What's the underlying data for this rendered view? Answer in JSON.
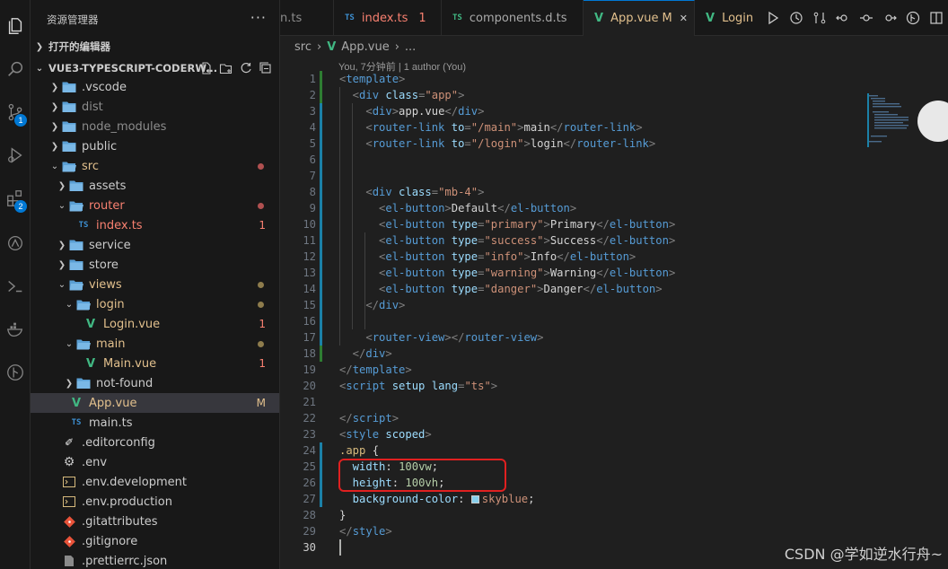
{
  "activity": {
    "source_control_badge": "1",
    "extensions_badge": "2"
  },
  "sidebar": {
    "title": "资源管理器",
    "more": "···",
    "open_editors": "打开的编辑器",
    "workspace": "VUE3-TYPESCRIPT-CODERW...",
    "tree": [
      {
        "label": "vscode",
        "prefix": ".",
        "type": "folder"
      },
      {
        "label": "dist",
        "type": "folder"
      },
      {
        "label": "node_modules",
        "type": "folder"
      },
      {
        "label": "public",
        "type": "folder"
      },
      {
        "label": "src",
        "type": "folder-open"
      },
      {
        "label": "assets",
        "type": "folder"
      },
      {
        "label": "router",
        "type": "folder-open"
      },
      {
        "label": "index.ts",
        "type": "ts",
        "status": "1"
      },
      {
        "label": "service",
        "type": "folder"
      },
      {
        "label": "store",
        "type": "folder"
      },
      {
        "label": "views",
        "type": "folder-open"
      },
      {
        "label": "login",
        "type": "folder-open"
      },
      {
        "label": "Login.vue",
        "type": "vue",
        "status": "1"
      },
      {
        "label": "main",
        "type": "folder-open"
      },
      {
        "label": "Main.vue",
        "type": "vue",
        "status": "1"
      },
      {
        "label": "not-found",
        "type": "folder"
      },
      {
        "label": "App.vue",
        "type": "vue",
        "status": "M"
      },
      {
        "label": "main.ts",
        "type": "ts"
      },
      {
        "label": ".editorconfig",
        "type": "config"
      },
      {
        "label": ".env",
        "type": "gear"
      },
      {
        "label": ".env.development",
        "type": "env"
      },
      {
        "label": ".env.production",
        "type": "env"
      },
      {
        "label": ".gitattributes",
        "type": "git"
      },
      {
        "label": ".gitignore",
        "type": "git"
      },
      {
        "label": ".prettierrc.json",
        "type": "json"
      }
    ]
  },
  "tabs": [
    {
      "label": "n.ts"
    },
    {
      "label": "index.ts",
      "status": "1",
      "icon": "TS"
    },
    {
      "label": "components.d.ts",
      "icon": "TS"
    },
    {
      "label": "App.vue",
      "status": "M",
      "close": "✕"
    },
    {
      "label": "Login"
    }
  ],
  "breadcrumb": {
    "folder": "src",
    "sep": "›",
    "file": "App.vue",
    "more": "..."
  },
  "codelens": "You, 7分钟前 | 1 author (You)",
  "watermark": "CSDN @学如逆水行舟~",
  "colors": {
    "accent": "#0078d4",
    "modified": "#e2c08d",
    "error": "#f88070",
    "vue": "#41b883",
    "ts": "#3d8fd1",
    "highlight_box": "#e02020"
  },
  "code_lines": [
    [
      [
        "t",
        "<"
      ],
      [
        "tag",
        "template"
      ],
      [
        "t",
        ">"
      ]
    ],
    [
      [
        "t",
        "  <"
      ],
      [
        "tag",
        "div"
      ],
      [
        "attr",
        " class"
      ],
      [
        "t",
        "="
      ],
      [
        "str",
        "\"app\""
      ],
      [
        "t",
        ">"
      ]
    ],
    [
      [
        "t",
        "    <"
      ],
      [
        "tag",
        "div"
      ],
      [
        "t",
        ">"
      ],
      [
        "txtc",
        "app.vue"
      ],
      [
        "t",
        "</"
      ],
      [
        "tag",
        "div"
      ],
      [
        "t",
        ">"
      ]
    ],
    [
      [
        "t",
        "    <"
      ],
      [
        "tag",
        "router-link"
      ],
      [
        "attr",
        " to"
      ],
      [
        "t",
        "="
      ],
      [
        "str",
        "\"/main\""
      ],
      [
        "t",
        ">"
      ],
      [
        "txtc",
        "main"
      ],
      [
        "t",
        "</"
      ],
      [
        "tag",
        "router-link"
      ],
      [
        "t",
        ">"
      ]
    ],
    [
      [
        "t",
        "    <"
      ],
      [
        "tag",
        "router-link"
      ],
      [
        "attr",
        " to"
      ],
      [
        "t",
        "="
      ],
      [
        "str",
        "\"/login\""
      ],
      [
        "t",
        ">"
      ],
      [
        "txtc",
        "login"
      ],
      [
        "t",
        "</"
      ],
      [
        "tag",
        "router-link"
      ],
      [
        "t",
        ">"
      ]
    ],
    [],
    [],
    [
      [
        "t",
        "    <"
      ],
      [
        "tag",
        "div"
      ],
      [
        "attr",
        " class"
      ],
      [
        "t",
        "="
      ],
      [
        "str",
        "\"mb-4\""
      ],
      [
        "t",
        ">"
      ]
    ],
    [
      [
        "t",
        "      <"
      ],
      [
        "tag",
        "el-button"
      ],
      [
        "t",
        ">"
      ],
      [
        "txtc",
        "Default"
      ],
      [
        "t",
        "</"
      ],
      [
        "tag",
        "el-button"
      ],
      [
        "t",
        ">"
      ]
    ],
    [
      [
        "t",
        "      <"
      ],
      [
        "tag",
        "el-button"
      ],
      [
        "attr",
        " type"
      ],
      [
        "t",
        "="
      ],
      [
        "str",
        "\"primary\""
      ],
      [
        "t",
        ">"
      ],
      [
        "txtc",
        "Primary"
      ],
      [
        "t",
        "</"
      ],
      [
        "tag",
        "el-button"
      ],
      [
        "t",
        ">"
      ]
    ],
    [
      [
        "t",
        "      <"
      ],
      [
        "tag",
        "el-button"
      ],
      [
        "attr",
        " type"
      ],
      [
        "t",
        "="
      ],
      [
        "str",
        "\"success\""
      ],
      [
        "t",
        ">"
      ],
      [
        "txtc",
        "Success"
      ],
      [
        "t",
        "</"
      ],
      [
        "tag",
        "el-button"
      ],
      [
        "t",
        ">"
      ]
    ],
    [
      [
        "t",
        "      <"
      ],
      [
        "tag",
        "el-button"
      ],
      [
        "attr",
        " type"
      ],
      [
        "t",
        "="
      ],
      [
        "str",
        "\"info\""
      ],
      [
        "t",
        ">"
      ],
      [
        "txtc",
        "Info"
      ],
      [
        "t",
        "</"
      ],
      [
        "tag",
        "el-button"
      ],
      [
        "t",
        ">"
      ]
    ],
    [
      [
        "t",
        "      <"
      ],
      [
        "tag",
        "el-button"
      ],
      [
        "attr",
        " type"
      ],
      [
        "t",
        "="
      ],
      [
        "str",
        "\"warning\""
      ],
      [
        "t",
        ">"
      ],
      [
        "txtc",
        "Warning"
      ],
      [
        "t",
        "</"
      ],
      [
        "tag",
        "el-button"
      ],
      [
        "t",
        ">"
      ]
    ],
    [
      [
        "t",
        "      <"
      ],
      [
        "tag",
        "el-button"
      ],
      [
        "attr",
        " type"
      ],
      [
        "t",
        "="
      ],
      [
        "str",
        "\"danger\""
      ],
      [
        "t",
        ">"
      ],
      [
        "txtc",
        "Danger"
      ],
      [
        "t",
        "</"
      ],
      [
        "tag",
        "el-button"
      ],
      [
        "t",
        ">"
      ]
    ],
    [
      [
        "t",
        "    </"
      ],
      [
        "tag",
        "div"
      ],
      [
        "t",
        ">"
      ]
    ],
    [],
    [
      [
        "t",
        "    <"
      ],
      [
        "tag",
        "router-view"
      ],
      [
        "t",
        "></"
      ],
      [
        "tag",
        "router-view"
      ],
      [
        "t",
        ">"
      ]
    ],
    [
      [
        "t",
        "  </"
      ],
      [
        "tag",
        "div"
      ],
      [
        "t",
        ">"
      ]
    ],
    [
      [
        "t",
        "</"
      ],
      [
        "tag",
        "template"
      ],
      [
        "t",
        ">"
      ]
    ],
    [
      [
        "t",
        "<"
      ],
      [
        "tag",
        "script"
      ],
      [
        "attr",
        " setup"
      ],
      [
        "attr",
        " lang"
      ],
      [
        "t",
        "="
      ],
      [
        "str",
        "\"ts\""
      ],
      [
        "t",
        ">"
      ]
    ],
    [],
    [
      [
        "t",
        "</"
      ],
      [
        "tag",
        "script"
      ],
      [
        "t",
        ">"
      ]
    ],
    [
      [
        "t",
        "<"
      ],
      [
        "tag",
        "style"
      ],
      [
        "attr",
        " scoped"
      ],
      [
        "t",
        ">"
      ]
    ],
    [
      [
        "sel",
        ".app"
      ],
      [
        "txtc",
        " {"
      ]
    ],
    [
      [
        "attr",
        "  width"
      ],
      [
        "txtc",
        ": "
      ],
      [
        "num",
        "100vw"
      ],
      [
        "txtc",
        ";"
      ]
    ],
    [
      [
        "attr",
        "  height"
      ],
      [
        "txtc",
        ": "
      ],
      [
        "num",
        "100vh"
      ],
      [
        "txtc",
        ";"
      ]
    ],
    [
      [
        "attr",
        "  background-color"
      ],
      [
        "txtc",
        ": "
      ],
      [
        "swatch",
        ""
      ],
      [
        "str",
        "skyblue"
      ],
      [
        "txtc",
        ";"
      ]
    ],
    [
      [
        "txtc",
        "}"
      ]
    ],
    [
      [
        "t",
        "</"
      ],
      [
        "tag",
        "style"
      ],
      [
        "t",
        ">"
      ]
    ],
    []
  ],
  "current_line": 30
}
